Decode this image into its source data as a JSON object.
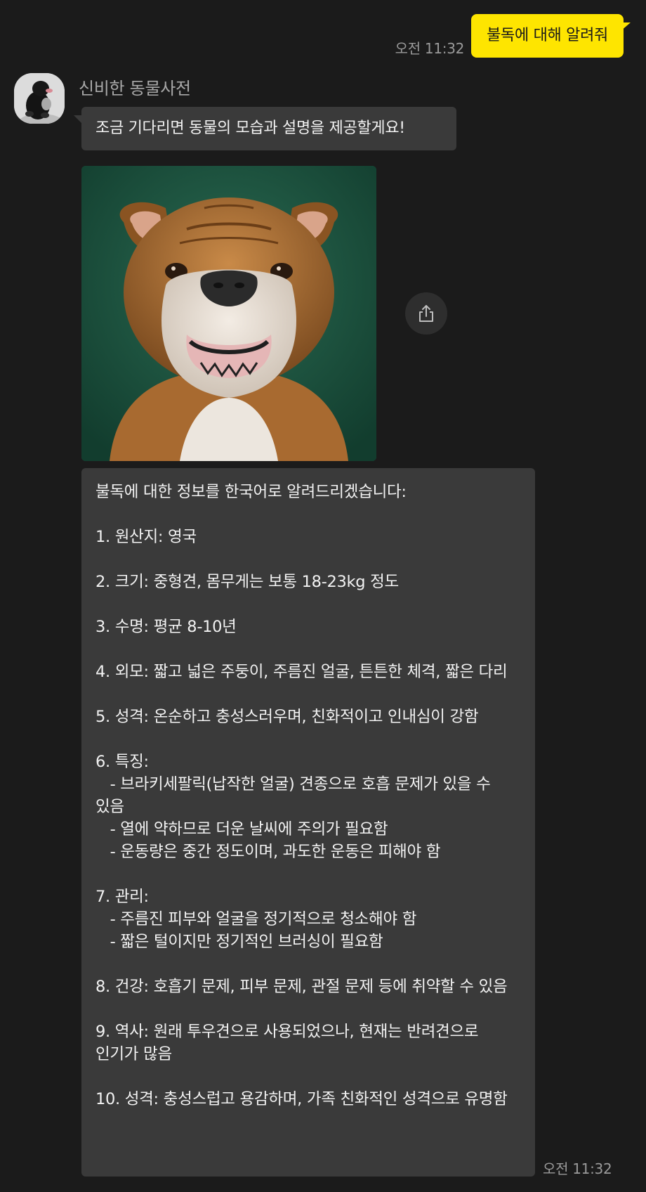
{
  "outgoing": {
    "time": "오전 11:32",
    "text": "불독에 대해 알려줘"
  },
  "incoming": {
    "sender_name": "신비한 동물사전",
    "avatar_icon": "mole-avatar-icon",
    "greeting": "조금 기다리면 동물의 모습과 설명을 제공할게요!",
    "image_subject": "bulldog-photo",
    "share_icon": "share-icon",
    "time": "오전 11:32",
    "info": {
      "lines": [
        "불독에 대한 정보를 한국어로 알려드리겠습니다:",
        "",
        "1. 원산지: 영국",
        "",
        "2. 크기: 중형견, 몸무게는 보통 18-23kg 정도",
        "",
        "3. 수명: 평균 8-10년",
        "",
        "4. 외모: 짧고 넓은 주둥이, 주름진 얼굴, 튼튼한 체격, 짧은 다리",
        "",
        "5. 성격: 온순하고 충성스러우며, 친화적이고 인내심이 강함",
        "",
        "6. 특징:",
        "   - 브라키세팔릭(납작한 얼굴) 견종으로 호흡 문제가 있을 수 있음",
        "   - 열에 약하므로 더운 날씨에 주의가 필요함",
        "   - 운동량은 중간 정도이며, 과도한 운동은 피해야 함",
        "",
        "7. 관리:",
        "   - 주름진 피부와 얼굴을 정기적으로 청소해야 함",
        "   - 짧은 털이지만 정기적인 브러싱이 필요함",
        "",
        "8. 건강: 호흡기 문제, 피부 문제, 관절 문제 등에 취약할 수 있음",
        "",
        "9. 역사: 원래 투우견으로 사용되었으나, 현재는 반려견으로 인기가 많음",
        "",
        "10. 성격: 충성스럽고 용감하며, 가족 친화적인 성격으로 유명함"
      ]
    }
  },
  "colors": {
    "background": "#1b1b1b",
    "outgoing_bubble": "#fee500",
    "incoming_bubble": "#3a3a3a",
    "timestamp": "#9a9a9a"
  }
}
